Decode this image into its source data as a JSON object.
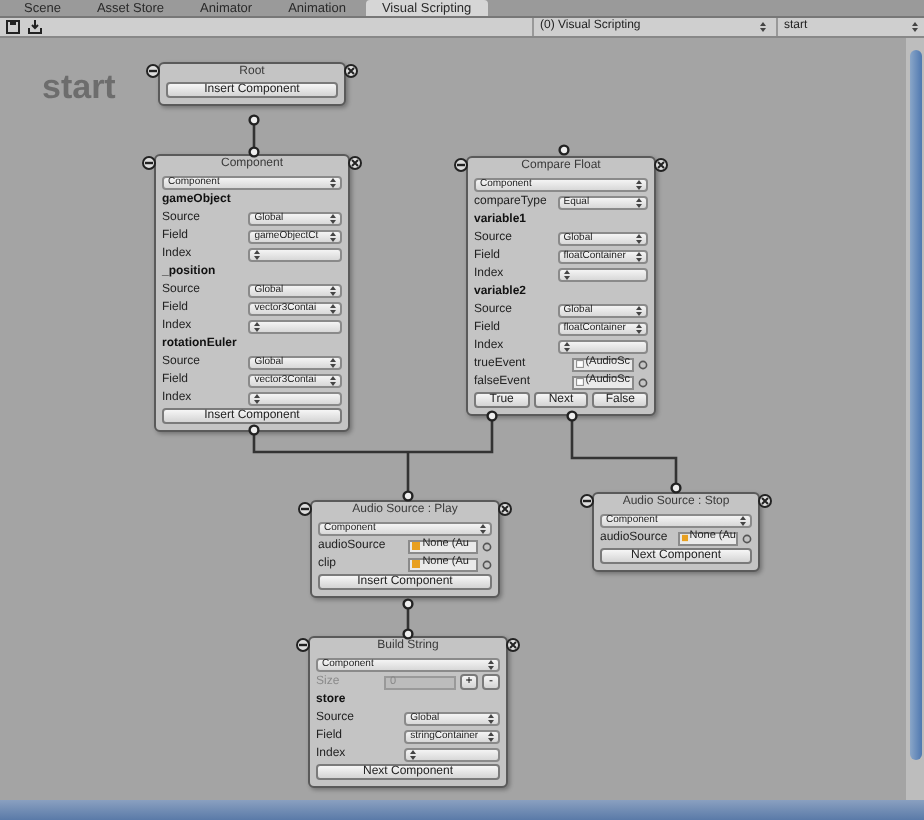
{
  "tabs": [
    {
      "label": "Scene",
      "selected": false
    },
    {
      "label": "Asset Store",
      "selected": false
    },
    {
      "label": "Animator",
      "selected": false
    },
    {
      "label": "Animation",
      "selected": false
    },
    {
      "label": "Visual Scripting",
      "selected": true
    }
  ],
  "toolbar": {
    "graph_select": "(0) Visual Scripting",
    "state_select": "start"
  },
  "canvas": {
    "state_label": "start",
    "nodes": [
      {
        "title": "Root",
        "rows": [
          {
            "kind": "button",
            "label": "Insert Component"
          }
        ]
      },
      {
        "title": "Component",
        "rows": [
          {
            "kind": "select",
            "value": "Component"
          },
          {
            "kind": "header",
            "label": "gameObject"
          },
          {
            "kind": "field",
            "label": "Source",
            "value": "Global"
          },
          {
            "kind": "field",
            "label": "Field",
            "value": "gameObjectCt"
          },
          {
            "kind": "field",
            "label": "Index"
          },
          {
            "kind": "header",
            "label": "_position"
          },
          {
            "kind": "field",
            "label": "Source",
            "value": "Global"
          },
          {
            "kind": "field",
            "label": "Field",
            "value": "vector3Contai"
          },
          {
            "kind": "field",
            "label": "Index"
          },
          {
            "kind": "header",
            "label": "rotationEuler"
          },
          {
            "kind": "field",
            "label": "Source",
            "value": "Global"
          },
          {
            "kind": "field",
            "label": "Field",
            "value": "vector3Contai"
          },
          {
            "kind": "field",
            "label": "Index"
          },
          {
            "kind": "button",
            "label": "Insert Component"
          }
        ]
      },
      {
        "title": "Compare Float",
        "rows": [
          {
            "kind": "select",
            "value": "Component"
          },
          {
            "kind": "field",
            "label": "compareType",
            "value": "Equal"
          },
          {
            "kind": "header",
            "label": "variable1"
          },
          {
            "kind": "field",
            "label": "Source",
            "value": "Global"
          },
          {
            "kind": "field",
            "label": "Field",
            "value": "floatContainer"
          },
          {
            "kind": "field",
            "label": "Index"
          },
          {
            "kind": "header",
            "label": "variable2"
          },
          {
            "kind": "field",
            "label": "Source",
            "value": "Global"
          },
          {
            "kind": "field",
            "label": "Field",
            "value": "floatContainer"
          },
          {
            "kind": "field",
            "label": "Index"
          },
          {
            "kind": "event",
            "label": "trueEvent",
            "value": "(AudioSc"
          },
          {
            "kind": "event",
            "label": "falseEvent",
            "value": "(AudioSc"
          },
          {
            "kind": "buttons",
            "labels": [
              "True",
              "Next",
              "False"
            ]
          }
        ]
      },
      {
        "title": "Audio Source : Play",
        "rows": [
          {
            "kind": "select",
            "value": "Component"
          },
          {
            "kind": "object",
            "label": "audioSource",
            "value": "None (Au"
          },
          {
            "kind": "object",
            "label": "clip",
            "value": "None (Au"
          },
          {
            "kind": "button",
            "label": "Insert Component"
          }
        ]
      },
      {
        "title": "Audio Source : Stop",
        "rows": [
          {
            "kind": "select",
            "value": "Component"
          },
          {
            "kind": "object",
            "label": "audioSource",
            "value": "None (Au"
          },
          {
            "kind": "button",
            "label": "Next Component"
          }
        ]
      },
      {
        "title": "Build String",
        "rows": [
          {
            "kind": "select",
            "value": "Component"
          },
          {
            "kind": "size",
            "label": "Size",
            "value": "0",
            "plus": "+",
            "minus": "-",
            "disabled": true
          },
          {
            "kind": "header",
            "label": "store"
          },
          {
            "kind": "field",
            "label": "Source",
            "value": "Global"
          },
          {
            "kind": "field",
            "label": "Field",
            "value": "stringContainer"
          },
          {
            "kind": "field",
            "label": "Index"
          },
          {
            "kind": "button",
            "label": "Next Component"
          }
        ]
      }
    ]
  }
}
